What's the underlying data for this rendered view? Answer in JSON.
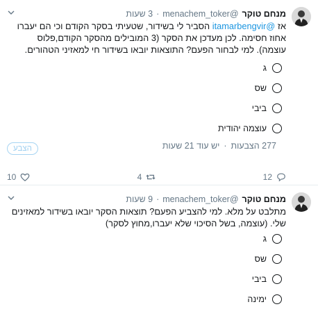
{
  "tweets": [
    {
      "name": "מנחם טוקר",
      "handle": "@menachem_toker",
      "dot": "·",
      "time": "3 שעות",
      "text_parts": {
        "before_mention": "אז ",
        "mention": "@itamarbengvir",
        "after_mention": " הסביר לי בשידור, שטעיתי בסקר הקודם וכי הם יעברו אחוז חסימה. לכן מעדכן את הסקר (3 המובילים מהסקר הקודם,פלוס עוצמה). למי לבחור הפעם? התוצאות יובאו בשידור חי למאזיני הטהורים."
      },
      "poll_options": [
        "ג",
        "שס",
        "ביבי",
        "עוצמה יהודית"
      ],
      "poll_votes": "277 הצבעות",
      "poll_time_left": "יש עוד 21 שעות",
      "vote_label": "הצבע",
      "actions": {
        "reply_count": "12",
        "retweet_count": "4",
        "like_count": "10"
      },
      "icons": {
        "reply": "reply-icon",
        "retweet": "retweet-icon",
        "like": "heart-icon",
        "caret": "chevron-down-icon"
      }
    },
    {
      "name": "מנחם טוקר",
      "handle": "@menachem_toker",
      "dot": "·",
      "time": "9 שעות",
      "text": "מתלבט על מלא. למי להצביע הפעם? תוצאות הסקר יובאו בשידור למאזינים שלי. (עוצמה, בשל הסיכוי שלא יעברו,מחוץ לסקר)",
      "poll_options": [
        "ג",
        "שס",
        "ביבי",
        "ימינה"
      ],
      "icons": {
        "caret": "chevron-down-icon"
      }
    }
  ],
  "colors": {
    "link": "#1b95e0",
    "muted": "#657786",
    "text": "#14171a",
    "vote_border": "#a6d4f2",
    "vote_text": "#9fcff0"
  }
}
